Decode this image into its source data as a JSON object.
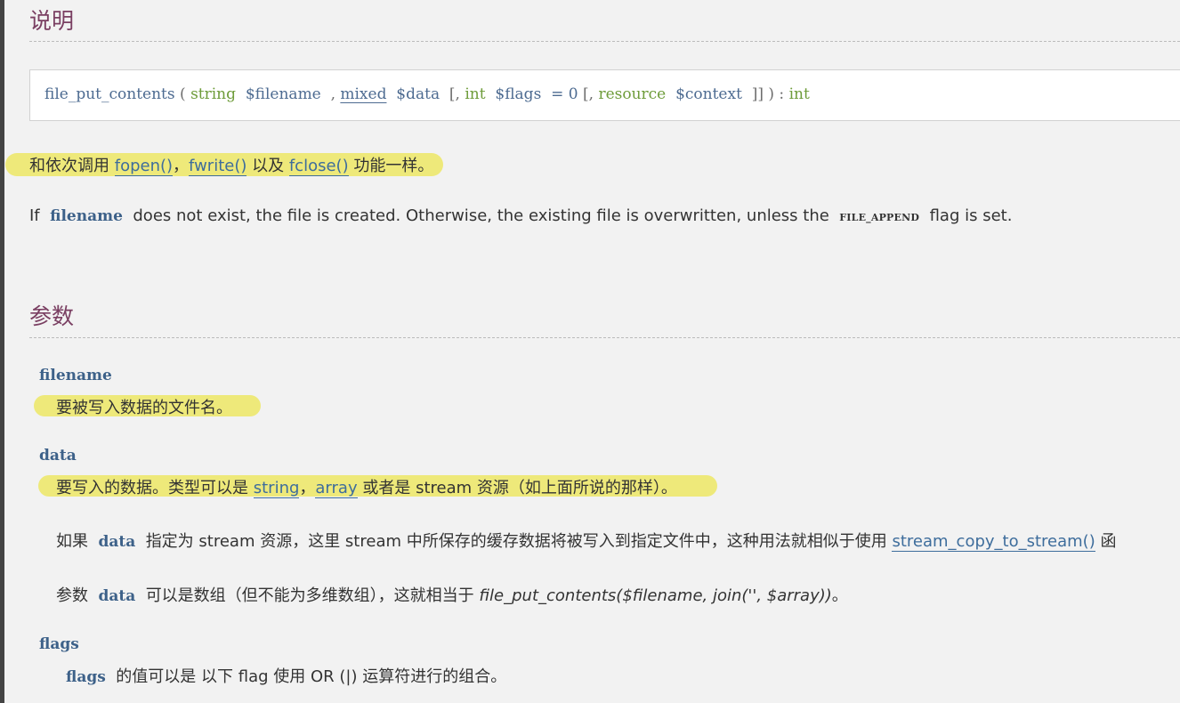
{
  "description": {
    "heading": "说明",
    "signature": {
      "fn": "file_put_contents",
      "open_paren": "(",
      "t1": "string",
      "p1": "$filename",
      "comma1": ",",
      "t2": "mixed",
      "p2": "$data",
      "opt1": "[,",
      "t3": "int",
      "p3": "$flags",
      "eq": "= 0",
      "opt2": "[,",
      "t4": "resource",
      "p4": "$context",
      "close": "]] ) :",
      "ret": "int"
    },
    "summary": {
      "prefix": "和依次调用",
      "fopen": "fopen()",
      "sep1": "，",
      "fwrite": "fwrite()",
      "mid": "以及",
      "fclose": "fclose()",
      "suffix": "功能一样。"
    },
    "note": {
      "if": "If",
      "filename": "filename",
      "middle": "does not exist, the file is created. Otherwise, the existing file is overwritten, unless the",
      "const": "FILE_APPEND",
      "end": "flag is set."
    }
  },
  "parameters": {
    "heading": "参数",
    "filename": {
      "name": "filename",
      "desc": "要被写入数据的文件名。"
    },
    "data": {
      "name": "data",
      "desc_prefix": "要写入的数据。类型可以是",
      "string_link": "string",
      "sep": "，",
      "array_link": "array",
      "desc_suffix": "或者是 stream 资源（如上面所说的那样）。",
      "p1_prefix": "如果",
      "p1_param": "data",
      "p1_text": "指定为 stream 资源，这里 stream 中所保存的缓存数据将被写入到指定文件中，这种用法就相似于使用",
      "p1_link": "stream_copy_to_stream()",
      "p1_tail": "函",
      "p2_prefix": "参数",
      "p2_param": "data",
      "p2_text": "可以是数组（但不能为多维数组），这就相当于",
      "p2_code": "file_put_contents($filename, join('', $array))",
      "p2_end": "。"
    },
    "flags": {
      "name": "flags",
      "desc_param": "flags",
      "desc_text": "的值可以是 以下 flag 使用 OR (|) 运算符进行的组合。"
    }
  },
  "colors": {
    "highlight": "#eee97a",
    "heading": "#7a3f62",
    "link": "#3e6d9c",
    "type": "#6e9c3a",
    "param": "#3d6189"
  }
}
